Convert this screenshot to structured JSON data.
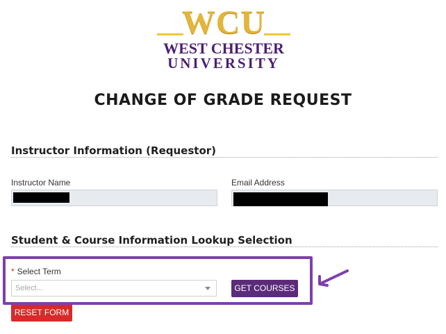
{
  "logo": {
    "line1": "WCU",
    "line2": "WEST CHESTER",
    "line3": "UNIVERSITY"
  },
  "page_title": "CHANGE OF GRADE REQUEST",
  "sections": {
    "instructor_title": "Instructor Information (Requestor)",
    "lookup_title": "Student & Course Information Lookup Selection"
  },
  "instructor": {
    "name_label": "Instructor Name",
    "email_label": "Email Address"
  },
  "lookup": {
    "term_required": "*",
    "term_label": "Select Term",
    "term_placeholder": "Select...",
    "get_courses_label": "GET COURSES",
    "reset_label": "RESET FORM"
  },
  "colors": {
    "brand_purple": "#5b2a79",
    "brand_gold": "#e2b53b",
    "reset_red": "#d72a2a",
    "annotation_purple": "#7d3fae"
  }
}
